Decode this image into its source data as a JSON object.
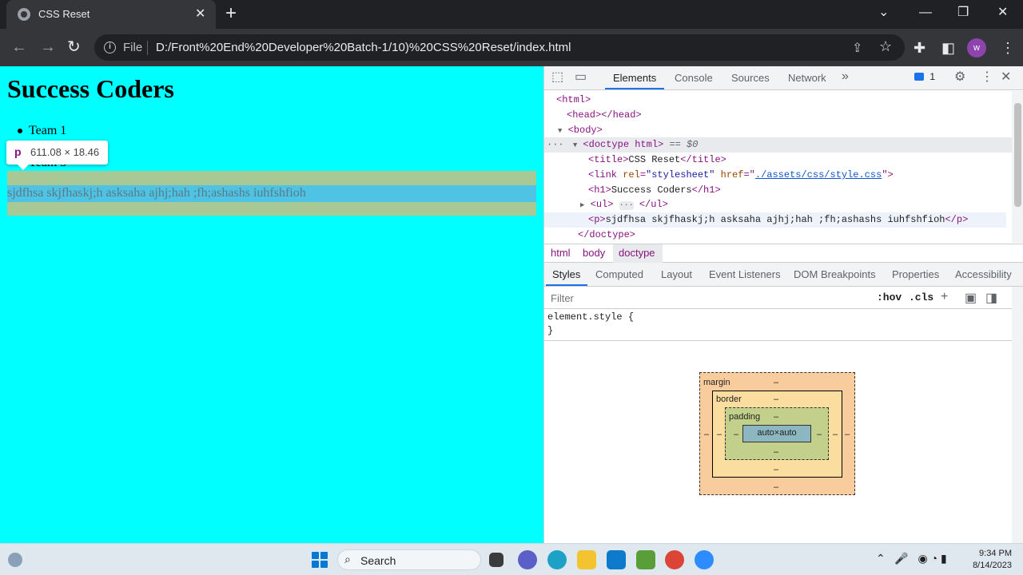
{
  "tab": {
    "title": "CSS Reset",
    "close": "✕",
    "new_tab": "+"
  },
  "window_controls": {
    "tab_search": "⌄",
    "minimize": "—",
    "restore": "❐",
    "close": "✕"
  },
  "omnibox": {
    "scheme_label": "File",
    "url": "D:/Front%20End%20Developer%20Batch-1/10)%20CSS%20Reset/index.html"
  },
  "profile": {
    "initial": "w"
  },
  "page": {
    "heading": "Success Coders",
    "list_items": [
      "Team 1",
      "Team 3"
    ],
    "paragraph": "sjdfhsa skjfhaskj;h asksaha ajhj;hah ;fh;ashashs iuhfshfioh"
  },
  "tooltip": {
    "tag": "p",
    "dimensions": "611.08 × 18.46"
  },
  "devtools": {
    "tabs": [
      "Elements",
      "Console",
      "Sources",
      "Network"
    ],
    "more_tabs": "»",
    "issues_count": "1",
    "dom": {
      "html_open": "<html>",
      "head": "<head></head>",
      "body_open": "<body>",
      "selected_marker": "== $0",
      "doctype_tag": "<doctype html>",
      "title_open": "<title>",
      "title_text": "CSS Reset",
      "title_close": "</title>",
      "link_open": "<link ",
      "link_rel_attr": "rel",
      "link_rel_val": "\"stylesheet\"",
      "link_href_attr": "href",
      "link_href_val": "./assets/css/style.css",
      "link_close": ">",
      "h1_open": "<h1>",
      "h1_text": "Success Coders",
      "h1_close": "</h1>",
      "ul_open": "<ul>",
      "ul_ellipsis": "···",
      "ul_close": "</ul>",
      "p_open": "<p>",
      "p_text": "sjdfhsa skjfhaskj;h asksaha ajhj;hah ;fh;ashashs iuhfshfioh",
      "p_close": "</p>",
      "doctype_close": "</doctype>"
    },
    "breadcrumbs": [
      "html",
      "body",
      "doctype"
    ],
    "styles_tabs": [
      "Styles",
      "Computed",
      "Layout",
      "Event Listeners",
      "DOM Breakpoints",
      "Properties",
      "Accessibility"
    ],
    "filter_placeholder": "Filter",
    "hov": ":hov",
    "cls": ".cls",
    "element_style_open": "element.style {",
    "element_style_close": "}",
    "box_model": {
      "margin_label": "margin",
      "border_label": "border",
      "padding_label": "padding",
      "content": "auto×auto",
      "dash": "–"
    }
  },
  "taskbar": {
    "search_label": "Search",
    "time": "9:34 PM",
    "date": "8/14/2023"
  },
  "colors": {
    "page_background": "#00ffff",
    "margin_highlight": "#a8c995",
    "content_highlight": "#4fc3e4",
    "devtools_accent": "#1a73e8",
    "avatar": "#8e44ad"
  }
}
